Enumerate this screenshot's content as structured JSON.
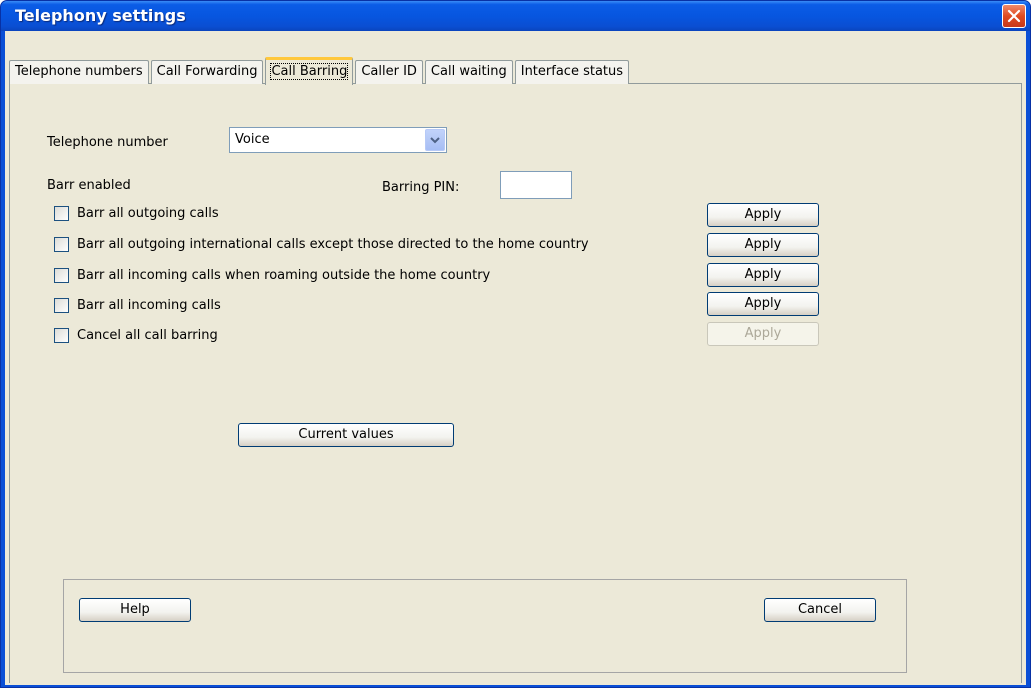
{
  "window": {
    "title": "Telephony settings"
  },
  "tabs": [
    {
      "label": "Telephone numbers"
    },
    {
      "label": "Call Forwarding"
    },
    {
      "label": "Call Barring"
    },
    {
      "label": "Caller ID"
    },
    {
      "label": "Call waiting"
    },
    {
      "label": "Interface status"
    }
  ],
  "form": {
    "telephone_number_label": "Telephone number",
    "telephone_number_value": "Voice",
    "barr_enabled_label": "Barr enabled",
    "barring_pin_label": "Barring PIN:",
    "barring_pin_value": ""
  },
  "options": [
    {
      "label": "Barr all outgoing calls",
      "checked": false,
      "apply": "Apply",
      "apply_enabled": true
    },
    {
      "label": "Barr all outgoing international calls except those directed to the home country",
      "checked": false,
      "apply": "Apply",
      "apply_enabled": true
    },
    {
      "label": "Barr all incoming calls when roaming outside the home country",
      "checked": false,
      "apply": "Apply",
      "apply_enabled": true
    },
    {
      "label": "Barr all incoming calls",
      "checked": false,
      "apply": "Apply",
      "apply_enabled": true
    },
    {
      "label": "Cancel all call barring",
      "checked": false,
      "apply": "Apply",
      "apply_enabled": false
    }
  ],
  "buttons": {
    "current_values": "Current values",
    "help": "Help",
    "cancel": "Cancel"
  },
  "colors": {
    "titlebar": "#0a4fd6",
    "dialog_bg": "#ece9d8",
    "close_button": "#e04b21",
    "active_tab_accent": "#ffc83c"
  },
  "icons": {
    "close": "close-icon",
    "dropdown": "chevron-down-icon"
  }
}
